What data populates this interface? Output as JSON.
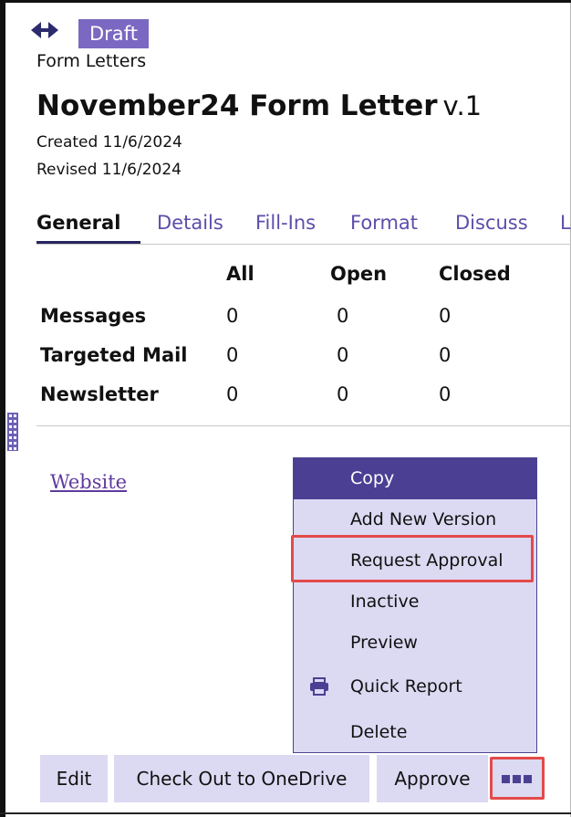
{
  "status_badge": "Draft",
  "breadcrumb": "Form Letters",
  "title": "November24 Form Letter",
  "version": "v.1",
  "created": "Created 11/6/2024",
  "revised": "Revised 11/6/2024",
  "tabs": [
    {
      "label": "General"
    },
    {
      "label": "Details"
    },
    {
      "label": "Fill-Ins"
    },
    {
      "label": "Format"
    },
    {
      "label": "Discuss"
    },
    {
      "label": "L"
    }
  ],
  "stats": {
    "headers": [
      "All",
      "Open",
      "Closed"
    ],
    "rows": [
      {
        "label": "Messages",
        "values": [
          "0",
          "0",
          "0"
        ]
      },
      {
        "label": "Targeted Mail",
        "values": [
          "0",
          "0",
          "0"
        ]
      },
      {
        "label": "Newsletter",
        "values": [
          "0",
          "0",
          "0"
        ]
      }
    ]
  },
  "website_link": "Website",
  "menu": {
    "items": [
      {
        "label": "Copy"
      },
      {
        "label": "Add New Version"
      },
      {
        "label": "Request Approval"
      },
      {
        "label": "Inactive"
      },
      {
        "label": "Preview"
      },
      {
        "label": "Quick Report",
        "icon": "printer-icon"
      },
      {
        "label": "Delete"
      }
    ]
  },
  "actions": {
    "edit": "Edit",
    "checkout": "Check Out to OneDrive",
    "approve": "Approve"
  },
  "colors": {
    "accent": "#7a68c2",
    "menu_bg": "#dcd9f2",
    "menu_selected": "#4b3f94",
    "tab_link": "#5b4eaa",
    "highlight": "#e34a4a"
  }
}
